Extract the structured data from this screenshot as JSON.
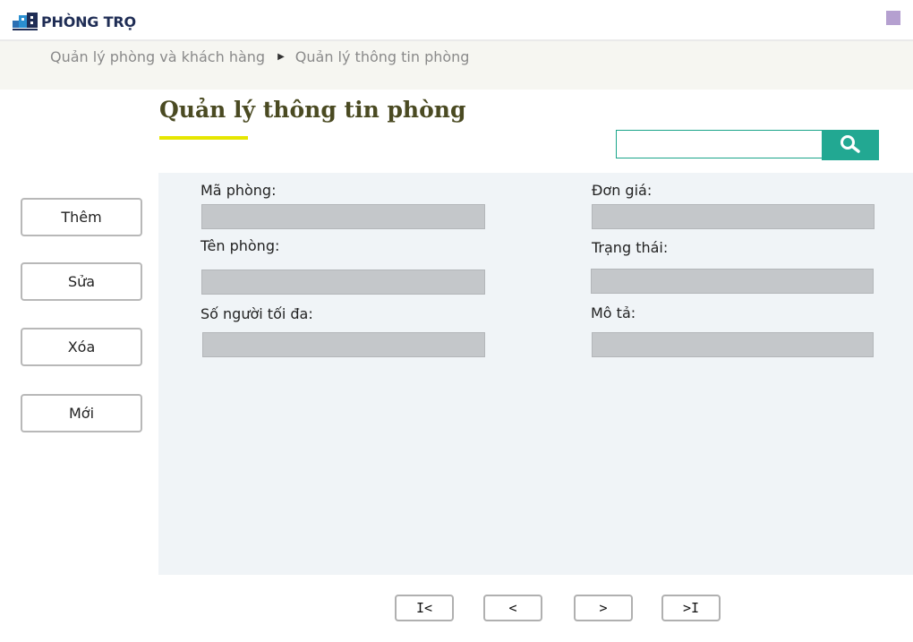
{
  "app": {
    "logo_text": "PHÒNG TRỌ",
    "brand_color": "#1f2d55",
    "accent_color": "#22a892"
  },
  "breadcrumb": {
    "items": [
      "Quản lý phòng và khách hàng",
      "Quản lý thông tin phòng"
    ],
    "separator_icon": "triangle-right-icon"
  },
  "page": {
    "title": "Quản lý thông tin phòng"
  },
  "search": {
    "value": "",
    "placeholder": "",
    "icon": "search-icon"
  },
  "actions": {
    "add_label": "Thêm",
    "edit_label": "Sửa",
    "delete_label": "Xóa",
    "new_label": "Mới"
  },
  "form": {
    "room_code": {
      "label": "Mã phòng:",
      "value": ""
    },
    "room_name": {
      "label": "Tên phòng:",
      "value": ""
    },
    "max_people": {
      "label": "Số người tối đa:",
      "value": ""
    },
    "unit_price": {
      "label": "Đơn giá:",
      "value": ""
    },
    "status": {
      "label": "Trạng thái:",
      "value": ""
    },
    "description": {
      "label": "Mô tả:",
      "value": ""
    }
  },
  "pager": {
    "first_label": "I<",
    "prev_label": "<",
    "next_label": ">",
    "last_label": ">I"
  }
}
